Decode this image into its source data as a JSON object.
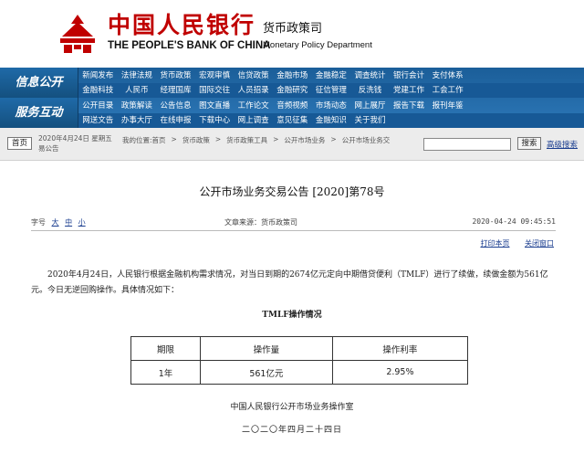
{
  "header": {
    "bank_name_cn": "中国人民银行",
    "bank_name_en": "THE PEOPLE'S BANK OF CHINA",
    "dept_name_cn": "货币政策司",
    "dept_name_en": "Monetary Policy Department"
  },
  "nav": {
    "section1_label": "信息公开",
    "section2_label": "服务互动",
    "row1": [
      "新闻发布",
      "法律法规",
      "货币政策",
      "宏观审慎",
      "信贷政策",
      "金融市场",
      "金融稳定",
      "调查统计",
      "银行会计",
      "支付体系"
    ],
    "row2": [
      "金融科技",
      "人民币",
      "经理国库",
      "国际交往",
      "人员招录",
      "金融研究",
      "征信管理",
      "反洗钱",
      "党建工作",
      "工会工作"
    ],
    "row3": [
      "公开目录",
      "政策解读",
      "公告信息",
      "图文直播",
      "工作论文",
      "音频视频",
      "市场动态",
      "网上展厅",
      "报告下载",
      "报刊年鉴"
    ],
    "row4": [
      "网送文告",
      "办事大厅",
      "在线申报",
      "下载中心",
      "网上调查",
      "意见征集",
      "金融知识",
      "关于我们"
    ]
  },
  "breadcrumb": {
    "home_label": "首页",
    "date_text": "2020年4月24日 星期五 易公告",
    "items": [
      "我的位置:首页",
      ">",
      "货币政策",
      ">",
      "货币政策工具",
      ">",
      "公开市场业务",
      ">",
      "公开市场业务交"
    ],
    "search_label": "搜索",
    "advanced_search_label": "高级搜索"
  },
  "article": {
    "title": "公开市场业务交易公告 [2020]第78号",
    "fontsize_label": "字号",
    "fontsizes": [
      "大",
      "中",
      "小"
    ],
    "source": "文章来源：货币政策司",
    "pubtime": "2020-04-24 09:45:51",
    "print_label": "打印本页",
    "close_label": "关闭窗口",
    "body": "2020年4月24日，人民银行根据金融机构需求情况，对当日到期的2674亿元定向中期借贷便利（TMLF）进行了续做，续做金额为561亿元。今日无逆回购操作。具体情况如下：",
    "table_title": "TMLF操作情况",
    "table_headers": [
      "期限",
      "操作量",
      "操作利率"
    ],
    "table_row": [
      "1年",
      "561亿元",
      "2.95%"
    ],
    "office": "中国人民银行公开市场业务操作室",
    "date_cn": "二〇二〇年四月二十四日"
  },
  "colors": {
    "brand_red": "#c00000",
    "nav_blue": "#1f6aa8",
    "link_blue": "#1a3d8f"
  }
}
